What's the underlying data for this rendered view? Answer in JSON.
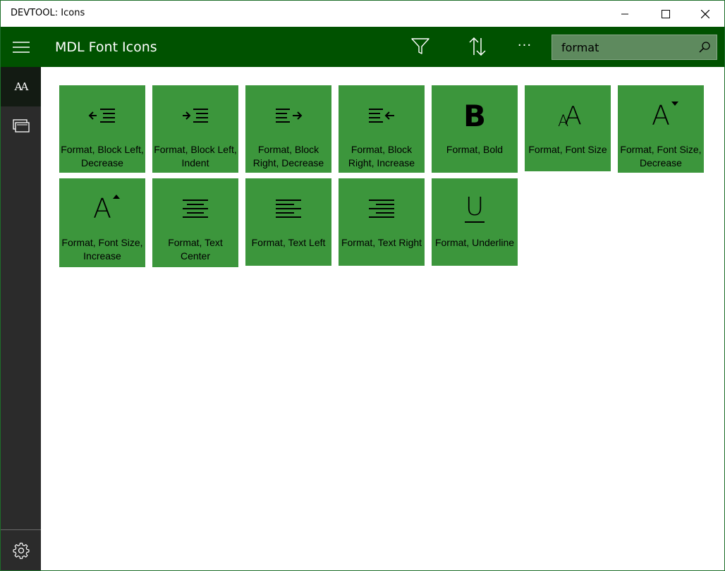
{
  "window": {
    "title": "DEVTOOL: Icons",
    "controls": {
      "minimize": "minimize-icon",
      "maximize": "maximize-icon",
      "close": "close-icon"
    }
  },
  "appbar": {
    "title": "MDL Font Icons",
    "more_label": "···",
    "search": {
      "value": "format",
      "placeholder": ""
    }
  },
  "nav": {
    "items": [
      {
        "icon": "font-icon",
        "glyph": "AA"
      },
      {
        "icon": "images-icon"
      },
      {
        "icon": "settings-icon"
      }
    ]
  },
  "tiles": [
    {
      "label": "Format, Block Left, Decrease",
      "icon": "block-left-decrease-icon"
    },
    {
      "label": "Format, Block Left, Indent",
      "icon": "block-left-indent-icon"
    },
    {
      "label": "Format, Block Right, Decrease",
      "icon": "block-right-decrease-icon"
    },
    {
      "label": "Format, Block Right, Increase",
      "icon": "block-right-increase-icon"
    },
    {
      "label": "Format, Bold",
      "icon": "bold-icon",
      "glyph": "B"
    },
    {
      "label": "Format, Font Size",
      "icon": "font-size-icon",
      "glyph": "AA"
    },
    {
      "label": "Format, Font Size, Decrease",
      "icon": "font-size-decrease-icon",
      "glyph": "A"
    },
    {
      "label": "Format, Font Size, Increase",
      "icon": "font-size-increase-icon",
      "glyph": "A"
    },
    {
      "label": "Format, Text Center",
      "icon": "text-center-icon"
    },
    {
      "label": "Format, Text Left",
      "icon": "text-left-icon"
    },
    {
      "label": "Format, Text Right",
      "icon": "text-right-icon"
    },
    {
      "label": "Format, Underline",
      "icon": "underline-icon",
      "glyph": "U"
    }
  ],
  "colors": {
    "appbar": "#005200",
    "tile": "#3c963c",
    "nav": "#2b2b2b",
    "search_bg": "#5e8a5e"
  }
}
